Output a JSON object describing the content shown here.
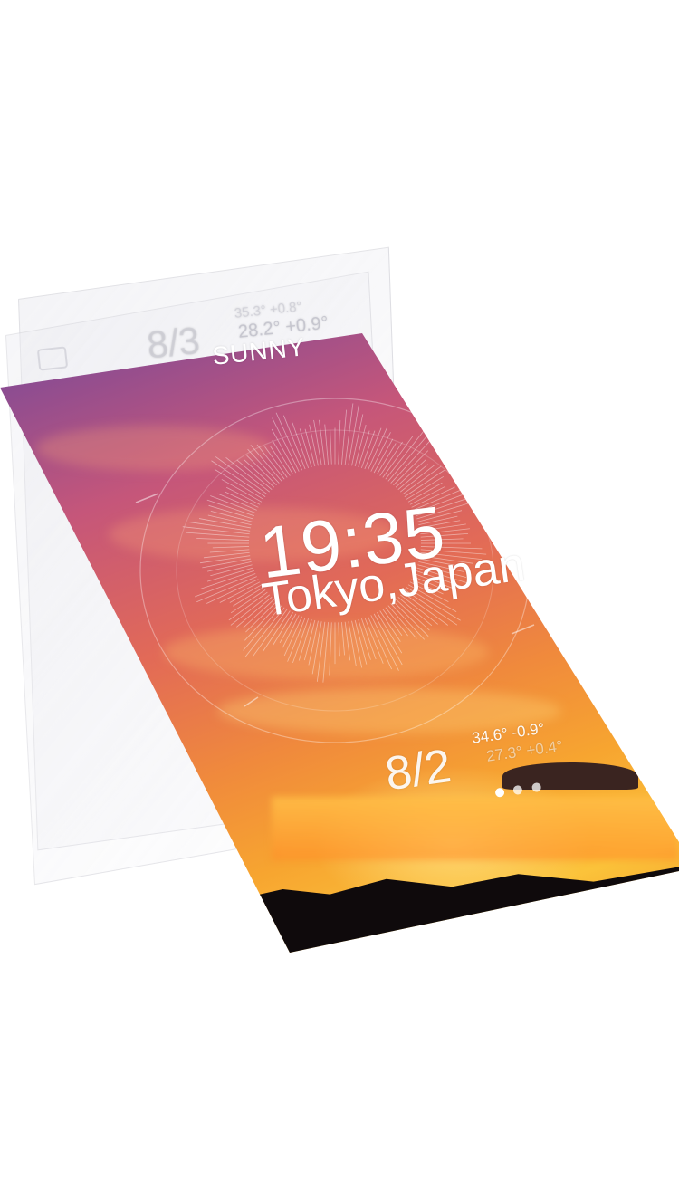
{
  "lockscreen": {
    "condition": "SUNNY",
    "time": "19:35",
    "location": "Tokyo,Japan"
  },
  "forecast_next": {
    "date": "8/3",
    "high": "35.3° +0.8°",
    "low": "28.2° +0.9°"
  },
  "forecast_current": {
    "date": "8/2",
    "high": "34.6° -0.9°",
    "low": "27.3° +0.4°"
  },
  "pager": {
    "count": 3,
    "active_index": 0
  },
  "colors": {
    "sky_top": "#2b2f6e",
    "sky_mid": "#e26a57",
    "sunset": "#f7a530",
    "land": "#0f0a0c"
  }
}
